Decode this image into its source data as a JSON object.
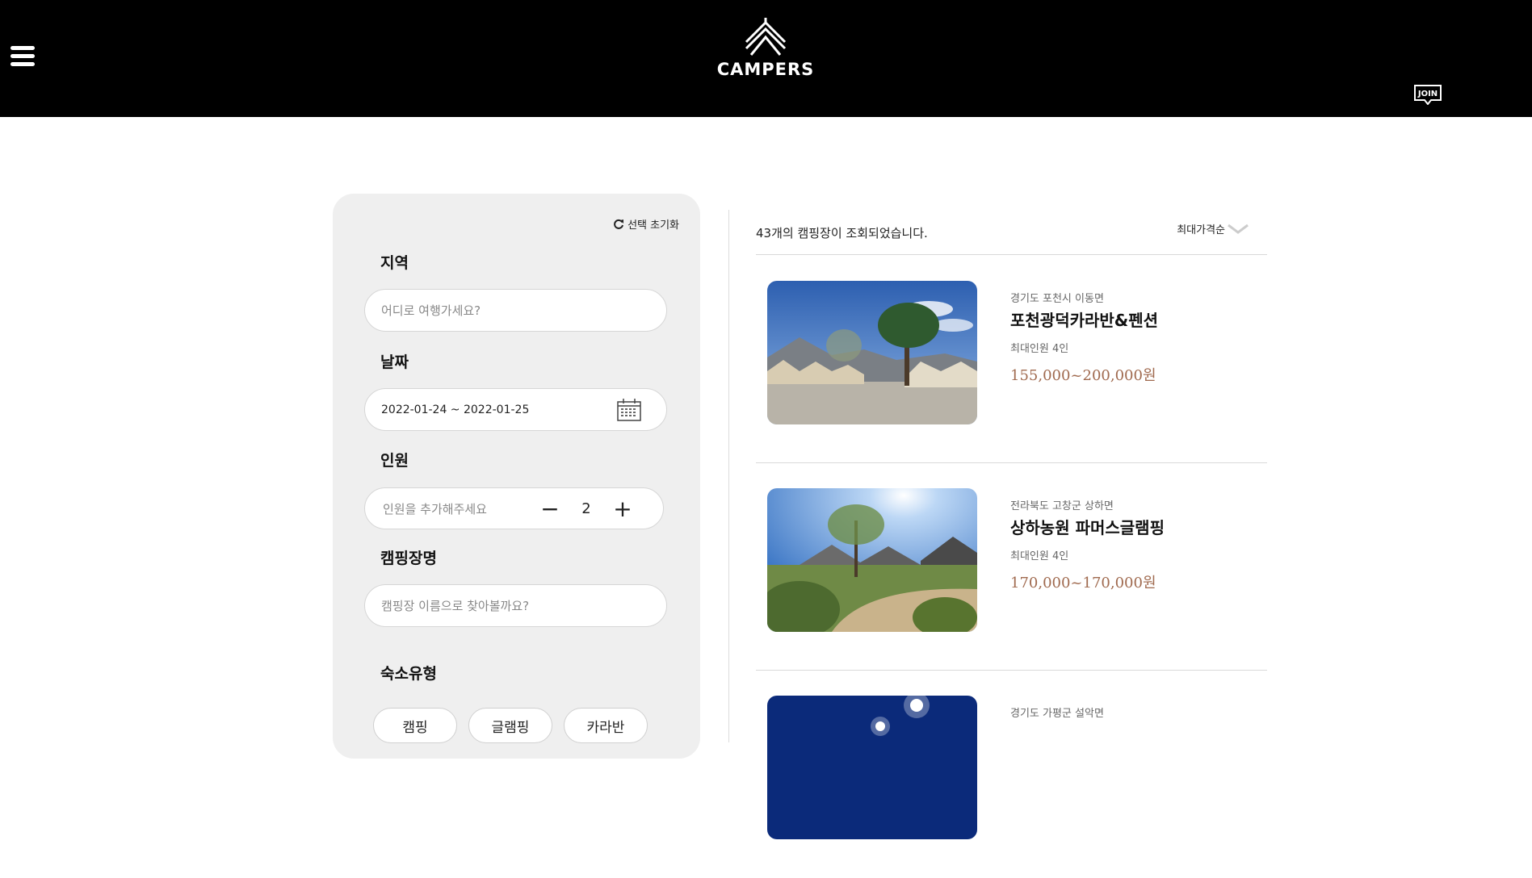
{
  "header": {
    "logo_text": "CAMPERS",
    "join_label": "JOIN"
  },
  "filter": {
    "reset_label": "선택 초기화",
    "region": {
      "label": "지역",
      "placeholder": "어디로 여행가세요?"
    },
    "date": {
      "label": "날짜",
      "value": "2022-01-24 ~ 2022-01-25"
    },
    "people": {
      "label": "인원",
      "placeholder": "인원을 추가해주세요",
      "count": "2",
      "minus": "−",
      "plus": "+"
    },
    "camp_name": {
      "label": "캠핑장명",
      "placeholder": "캠핑장 이름으로 찾아볼까요?"
    },
    "lodging": {
      "label": "숙소유형",
      "options": [
        "캠핑",
        "글램핑",
        "카라반"
      ]
    }
  },
  "results": {
    "count_text": "43개의 캠핑장이 조회되었습니다.",
    "sort_label": "최대가격순",
    "items": [
      {
        "location": "경기도 포천시 이동면",
        "name": "포천광덕카라반&펜션",
        "capacity": "최대인원 4인",
        "price": "155,000~200,000원"
      },
      {
        "location": "전라북도 고창군 상하면",
        "name": "상하농원 파머스글램핑",
        "capacity": "최대인원 4인",
        "price": "170,000~170,000원"
      },
      {
        "location": "경기도 가평군 설악면",
        "name": "",
        "capacity": "",
        "price": ""
      }
    ]
  },
  "colors": {
    "header_bg": "#000000",
    "filter_bg": "#efefef",
    "price": "#a06a4f"
  }
}
